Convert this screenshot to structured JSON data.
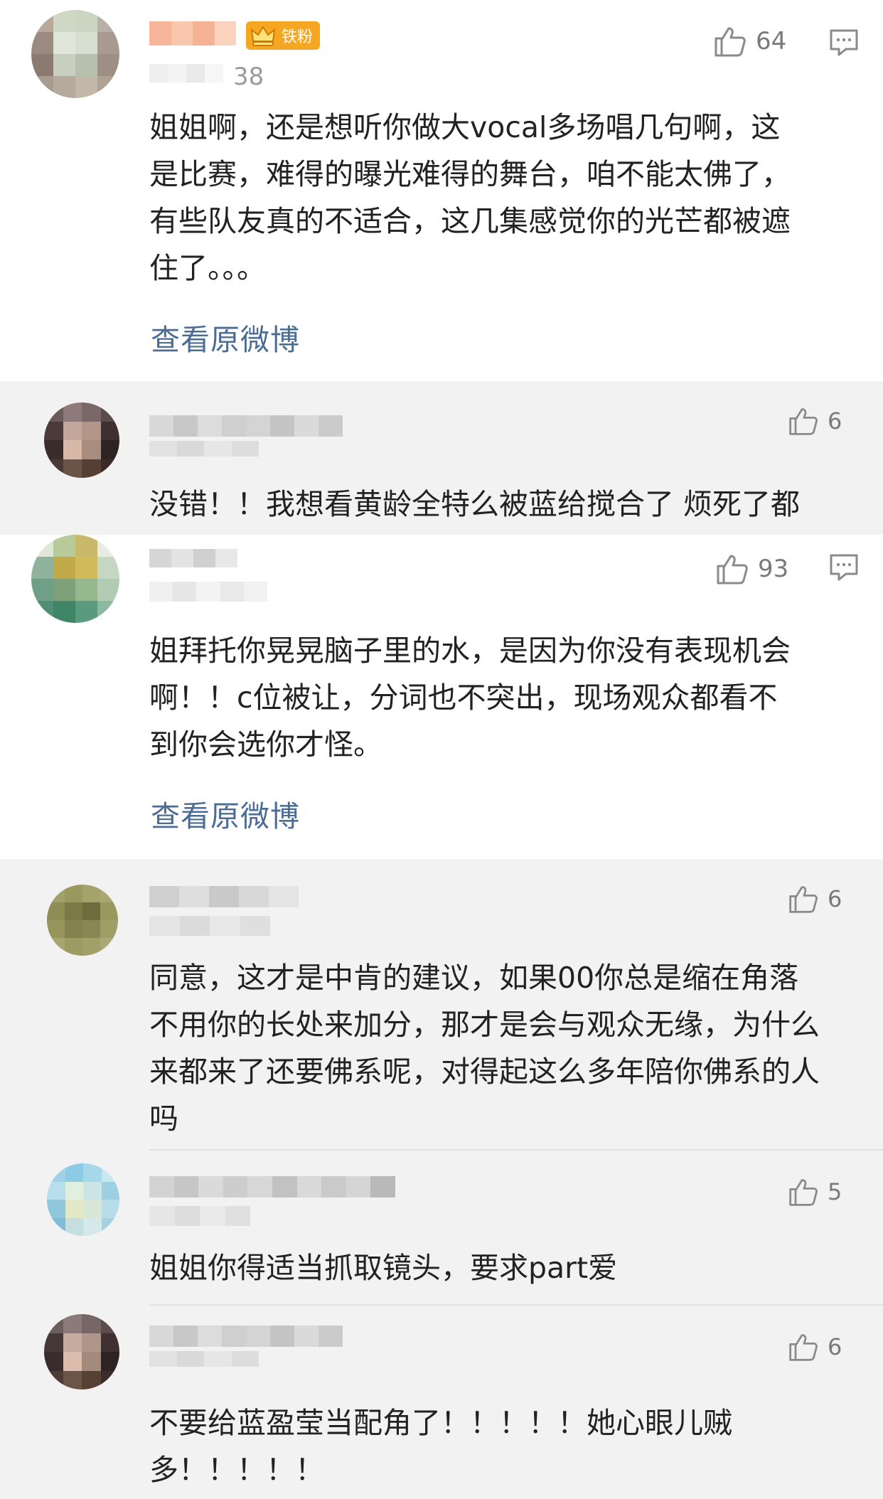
{
  "comments": [
    {
      "meta_number": "38",
      "badge": "铁粉",
      "likes": "64",
      "text": "姐姐啊，还是想听你做大vocal多场唱几句啊，这\n是比赛，难得的曝光难得的舞台，咱不能太佛了，\n有些队友真的不适合，这几集感觉你的光芒都被遮\n住了。。。",
      "view_original": "查看原微博",
      "replies": [
        {
          "likes": "6",
          "text": "没错！！我想看黄龄全特么被蓝给搅合了 烦死了都"
        }
      ]
    },
    {
      "likes": "93",
      "text": "姐拜托你晃晃脑子里的水，是因为你没有表现机会\n啊！！c位被让，分词也不突出，现场观众都看不\n到你会选你才怪。",
      "view_original": "查看原微博",
      "replies": [
        {
          "likes": "6",
          "text": "同意，这才是中肯的建议，如果00你总是缩在角落\n不用你的长处来加分，那才是会与观众无缘，为什么\n来都来了还要佛系呢，对得起这么多年陪你佛系的人\n吗"
        },
        {
          "likes": "5",
          "text": "姐姐你得适当抓取镜头，要求part爱"
        },
        {
          "likes": "6",
          "text": "不要给蓝盈莹当配角了！！！！！她心眼儿贼\n多！！！！！"
        }
      ]
    }
  ],
  "colors": {
    "link": "#4a6c95",
    "icon_gray": "#8a8a8a",
    "reply_bg": "#f2f2f2",
    "badge": "#f5a623"
  },
  "icons": [
    "thumbs-up-icon",
    "comment-icon",
    "crown-icon"
  ]
}
